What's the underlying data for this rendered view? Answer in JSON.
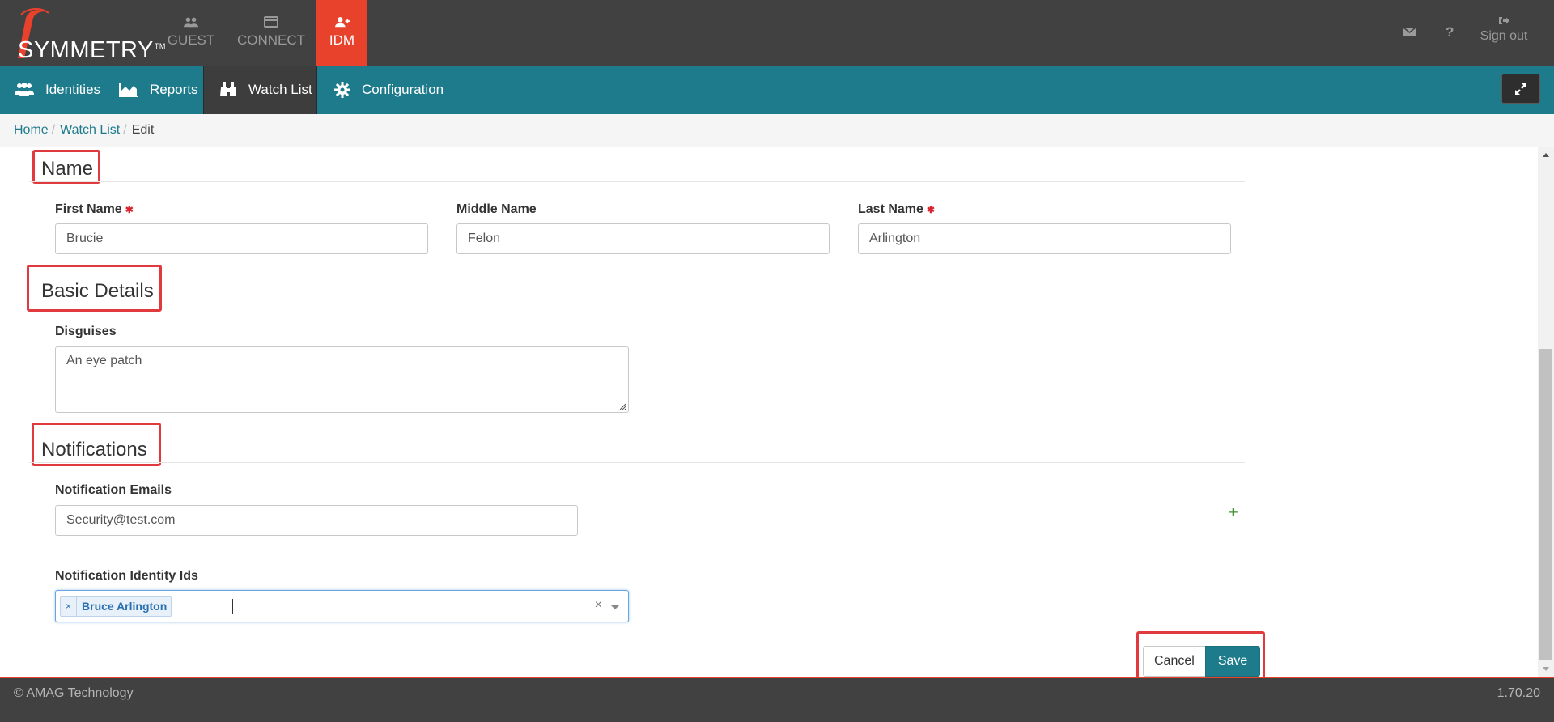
{
  "logo": {
    "text": "SYMMETRY",
    "tm": "TM"
  },
  "app_tabs": [
    {
      "label": "GUEST",
      "icon": "users-icon"
    },
    {
      "label": "CONNECT",
      "icon": "card-icon"
    },
    {
      "label": "IDM",
      "icon": "user-plus-icon",
      "active": true
    }
  ],
  "top_right": {
    "mail_icon": "envelope-icon",
    "help_glyph": "?",
    "signout_label": "Sign out"
  },
  "nav": {
    "items": [
      {
        "label": "Identities",
        "icon": "users-icon"
      },
      {
        "label": "Reports",
        "icon": "area-chart-icon"
      },
      {
        "label": "Watch List",
        "icon": "binoculars-icon",
        "active": true
      },
      {
        "label": "Configuration",
        "icon": "gear-icon"
      }
    ]
  },
  "breadcrumb": {
    "home": "Home",
    "watch_list": "Watch List",
    "current": "Edit",
    "sep": "/"
  },
  "sections": {
    "name": {
      "title": "Name",
      "first_name_label": "First Name",
      "first_name_value": "Brucie",
      "middle_name_label": "Middle Name",
      "middle_name_value": "Felon",
      "last_name_label": "Last Name",
      "last_name_value": "Arlington",
      "required_mark": "✱"
    },
    "basic_details": {
      "title": "Basic Details",
      "disguises_label": "Disguises",
      "disguises_value": "An eye patch"
    },
    "notifications": {
      "title": "Notifications",
      "emails_label": "Notification Emails",
      "email_value": "Security@test.com",
      "add_glyph": "+",
      "identity_ids_label": "Notification Identity Ids",
      "identity_tag": "Bruce Arlington",
      "tag_remove": "×",
      "clear_glyph": "×"
    }
  },
  "actions": {
    "cancel": "Cancel",
    "save": "Save"
  },
  "footer": {
    "copyright": "© AMAG Technology",
    "version": "1.70.20"
  },
  "colors": {
    "topbar": "#414141",
    "navbar": "#1d7b8c",
    "accent_red": "#e8412c",
    "annotation": "#e0393e",
    "save": "#1d7b8c"
  }
}
